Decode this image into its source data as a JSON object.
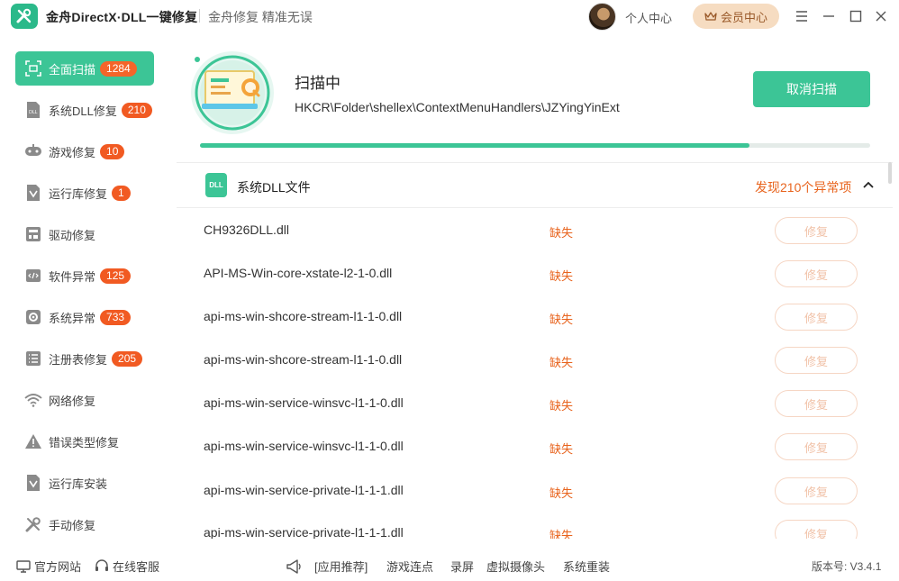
{
  "titlebar": {
    "app_title": "金舟DirectX·DLL一键修复",
    "slogan": "金舟修复 精准无误",
    "user_center": "个人中心",
    "vip_label": "会员中心",
    "icons": [
      "menu-icon",
      "minimize-icon",
      "maximize-icon",
      "close-icon"
    ]
  },
  "sidebar": {
    "items": [
      {
        "label": "全面扫描",
        "badge": "1284",
        "icon": "scan-icon",
        "active": true
      },
      {
        "label": "系统DLL修复",
        "badge": "210",
        "icon": "dll-icon"
      },
      {
        "label": "游戏修复",
        "badge": "10",
        "icon": "gamepad-icon"
      },
      {
        "label": "运行库修复",
        "badge": "1",
        "icon": "runtime-icon"
      },
      {
        "label": "驱动修复",
        "badge": "",
        "icon": "driver-icon"
      },
      {
        "label": "软件异常",
        "badge": "125",
        "icon": "code-icon"
      },
      {
        "label": "系统异常",
        "badge": "733",
        "icon": "gear-icon"
      },
      {
        "label": "注册表修复",
        "badge": "205",
        "icon": "registry-icon"
      },
      {
        "label": "网络修复",
        "badge": "",
        "icon": "wifi-icon"
      },
      {
        "label": "错误类型修复",
        "badge": "",
        "icon": "warning-icon"
      },
      {
        "label": "运行库安装",
        "badge": "",
        "icon": "runtime-install-icon"
      },
      {
        "label": "手动修复",
        "badge": "",
        "icon": "tools-icon"
      }
    ]
  },
  "scan": {
    "status": "扫描中",
    "path": "HKCR\\Folder\\shellex\\ContextMenuHandlers\\JZYingYinExt",
    "cancel_label": "取消扫描",
    "progress": 0.82
  },
  "group": {
    "icon_text": "DLL",
    "title": "系统DLL文件",
    "found": "发现210个异常项"
  },
  "rows": [
    {
      "name": "CH9326DLL.dll",
      "status": "缺失",
      "action": "修复"
    },
    {
      "name": "API-MS-Win-core-xstate-l2-1-0.dll",
      "status": "缺失",
      "action": "修复"
    },
    {
      "name": "api-ms-win-shcore-stream-l1-1-0.dll",
      "status": "缺失",
      "action": "修复"
    },
    {
      "name": "api-ms-win-shcore-stream-l1-1-0.dll",
      "status": "缺失",
      "action": "修复"
    },
    {
      "name": "api-ms-win-service-winsvc-l1-1-0.dll",
      "status": "缺失",
      "action": "修复"
    },
    {
      "name": "api-ms-win-service-winsvc-l1-1-0.dll",
      "status": "缺失",
      "action": "修复"
    },
    {
      "name": "api-ms-win-service-private-l1-1-1.dll",
      "status": "缺失",
      "action": "修复"
    },
    {
      "name": "api-ms-win-service-private-l1-1-1.dll",
      "status": "缺失",
      "action": "修复"
    }
  ],
  "footer": {
    "website": "官方网站",
    "support": "在线客服",
    "recommend": "[应用推荐]",
    "links": [
      "游戏连点",
      "录屏",
      "虚拟摄像头",
      "系统重装"
    ],
    "version": "版本号: V3.4.1"
  },
  "colors": {
    "accent": "#3cc596",
    "warning": "#e8641e",
    "badge": "#f15a22",
    "vip": "#f6dcc1"
  }
}
